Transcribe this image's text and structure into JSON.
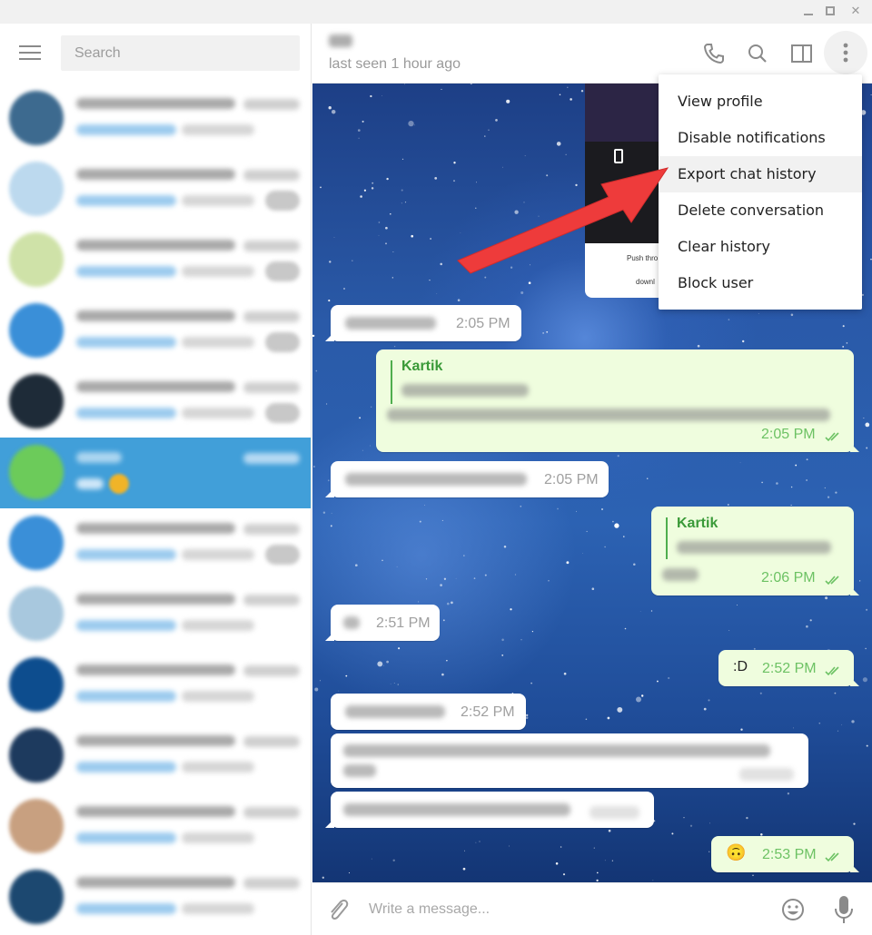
{
  "window": {
    "controls": {
      "minimize": "minimize",
      "maximize": "maximize",
      "close": "✕"
    }
  },
  "sidebar": {
    "search_placeholder": "Search",
    "chats": [
      {
        "avatar_color": "#3d6a8f",
        "selected": false,
        "has_badge": false
      },
      {
        "avatar_color": "#bcd9ee",
        "selected": false,
        "has_badge": true
      },
      {
        "avatar_color": "#cfe2a8",
        "selected": false,
        "has_badge": true
      },
      {
        "avatar_color": "#3a8fd8",
        "selected": false,
        "has_badge": true
      },
      {
        "avatar_color": "#1e2b38",
        "selected": false,
        "has_badge": true
      },
      {
        "avatar_color": "#6ccb5a",
        "selected": true,
        "has_badge": false
      },
      {
        "avatar_color": "#3a8fd8",
        "selected": false,
        "has_badge": true
      },
      {
        "avatar_color": "#a8c8de",
        "selected": false,
        "has_badge": false
      },
      {
        "avatar_color": "#0d4d8e",
        "selected": false,
        "has_badge": false
      },
      {
        "avatar_color": "#1d3a5e",
        "selected": false,
        "has_badge": false
      },
      {
        "avatar_color": "#c8a080",
        "selected": false,
        "has_badge": false
      },
      {
        "avatar_color": "#1c4870",
        "selected": false,
        "has_badge": false
      }
    ]
  },
  "chat": {
    "status": "last seen 1 hour ago",
    "header_icons": [
      "phone-icon",
      "search-icon",
      "sidebar-panel-icon",
      "more-vertical-icon"
    ],
    "messages": [
      {
        "direction": "in",
        "time": "2:05 PM"
      },
      {
        "direction": "out",
        "reply_to": "Kartik",
        "time": "2:05 PM",
        "read": true
      },
      {
        "direction": "in",
        "time": "2:05 PM"
      },
      {
        "direction": "out",
        "reply_to": "Kartik",
        "time": "2:06 PM",
        "read": true
      },
      {
        "direction": "in",
        "time": "2:51 PM"
      },
      {
        "direction": "out",
        "text": ":D",
        "time": "2:52 PM",
        "read": true
      },
      {
        "direction": "in",
        "time": "2:52 PM"
      },
      {
        "direction": "in",
        "time": ""
      },
      {
        "direction": "in",
        "time": ""
      },
      {
        "direction": "out",
        "text": "🙃",
        "time": "2:53 PM",
        "read": true
      }
    ],
    "screenshot_preview": {
      "line1": "Push thro",
      "line2": "downl"
    },
    "input_placeholder": "Write a message..."
  },
  "dropdown_menu": {
    "items": [
      {
        "label": "View profile"
      },
      {
        "label": "Disable notifications"
      },
      {
        "label": "Export chat history",
        "highlighted": true
      },
      {
        "label": "Delete conversation"
      },
      {
        "label": "Clear history"
      },
      {
        "label": "Block user"
      }
    ]
  },
  "annotation": {
    "arrow_color": "#ee3b3b",
    "points_to": "Export chat history"
  }
}
